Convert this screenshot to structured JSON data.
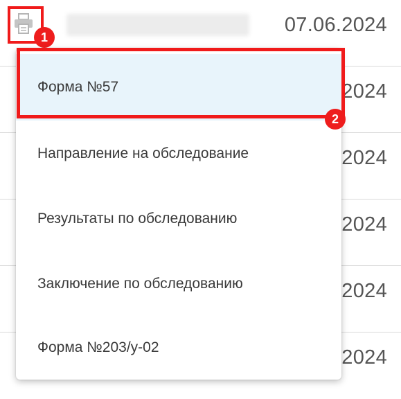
{
  "table": {
    "rows": [
      {
        "date": "07.06.2024"
      },
      {
        "date": "2024"
      },
      {
        "date": "2024"
      },
      {
        "date": "2024"
      },
      {
        "date": "2024"
      },
      {
        "date": "2024"
      }
    ]
  },
  "callouts": {
    "first": "1",
    "second": "2"
  },
  "menu": {
    "items": [
      {
        "label": "Форма №57"
      },
      {
        "label": "Направление на обследование"
      },
      {
        "label": "Результаты по обследованию"
      },
      {
        "label": "Заключение по обследованию"
      },
      {
        "label": "Форма №203/у-02"
      }
    ]
  },
  "colors": {
    "highlight": "#f01a1a",
    "active_item_bg": "#e8f4fb"
  },
  "icons": {
    "print": "printer-icon"
  }
}
